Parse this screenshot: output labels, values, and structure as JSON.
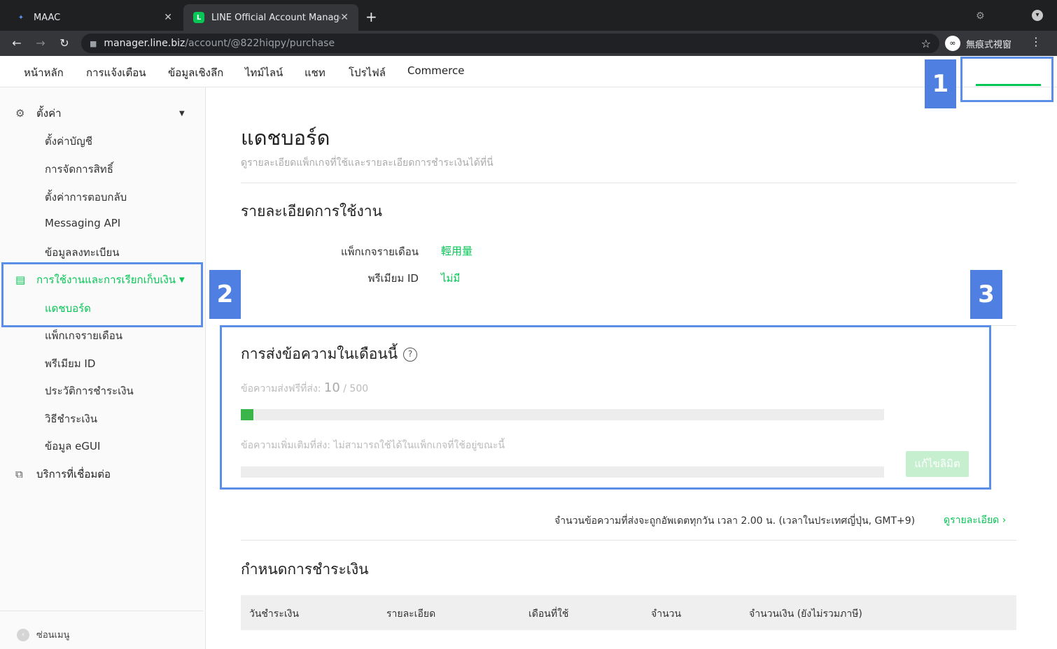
{
  "browser": {
    "tabs": [
      {
        "label": "MAAC",
        "favicon": "maac-logo"
      },
      {
        "label": "LINE Official Account Manager",
        "favicon": "line-logo"
      }
    ],
    "url_host": "manager.line.biz",
    "url_path": "/account/@822hiqpy/purchase",
    "incognito_label": "無痕式視窗"
  },
  "topnav": {
    "items": [
      "หน้าหลัก",
      "การแจ้งเตือน",
      "ข้อมูลเชิงลึก",
      "ไทม์ไลน์",
      "แชท",
      "โปรไฟล์",
      "Commerce"
    ],
    "settings": "ตั้งค่า"
  },
  "sidebar": {
    "settings_head": "ตั้งค่า",
    "settings_items": [
      "ตั้งค่าบัญชี",
      "การจัดการสิทธิ์",
      "ตั้งค่าการตอบกลับ",
      "Messaging API",
      "ข้อมูลลงทะเบียน"
    ],
    "billing_head": "การใช้งานและการเรียกเก็บเงิน",
    "billing_items": [
      "แดชบอร์ด",
      "แพ็กเกจรายเดือน",
      "พรีเมียม ID",
      "ประวัติการชำระเงิน",
      "วิธีชำระเงิน",
      "ข้อมูล eGUI"
    ],
    "services_head": "บริการที่เชื่อมต่อ",
    "hide_menu": "ซ่อนเมนู"
  },
  "main": {
    "title": "แดชบอร์ด",
    "description": "ดูรายละเอียดแพ็กเกจที่ใช้และรายละเอียดการชำระเงินได้ที่นี่",
    "usage_title": "รายละเอียดการใช้งาน",
    "plan_key": "แพ็กเกจรายเดือน",
    "plan_value": "輕用量",
    "premium_key": "พรีเมียม ID",
    "premium_value": "ไม่มี",
    "messages_title": "การส่งข้อความในเดือนนี้",
    "free_label": "ข้อความส่งฟรีที่ส่ง:",
    "free_used": "10",
    "free_total": " / 500",
    "free_progress": 0.02,
    "extra_label": "ข้อความเพิ่มเติมที่ส่ง: ไม่สามารถใช้ได้ในแพ็กเกจที่ใช้อยู่ขณะนี้",
    "extra_progress": 0,
    "limit_button": "แก้ไขลิมิต",
    "update_note": "จำนวนข้อความที่ส่งจะถูกอัพเดตทุกวัน เวลา 2.00 น. (เวลาในประเทศญี่ปุ่น, GMT+9)",
    "detail_link": "ดูรายละเอียด",
    "payment_title": "กำหนดการชำระเงิน",
    "table_headers": [
      "วันชำระเงิน",
      "รายละเอียด",
      "เดือนที่ใช้",
      "จำนวน",
      "จำนวนเงิน (ยังไม่รวมภาษี)"
    ]
  },
  "callouts": [
    "1",
    "2",
    "3"
  ],
  "colors": {
    "accent": "#06c755",
    "callout": "#4f7fe0"
  }
}
